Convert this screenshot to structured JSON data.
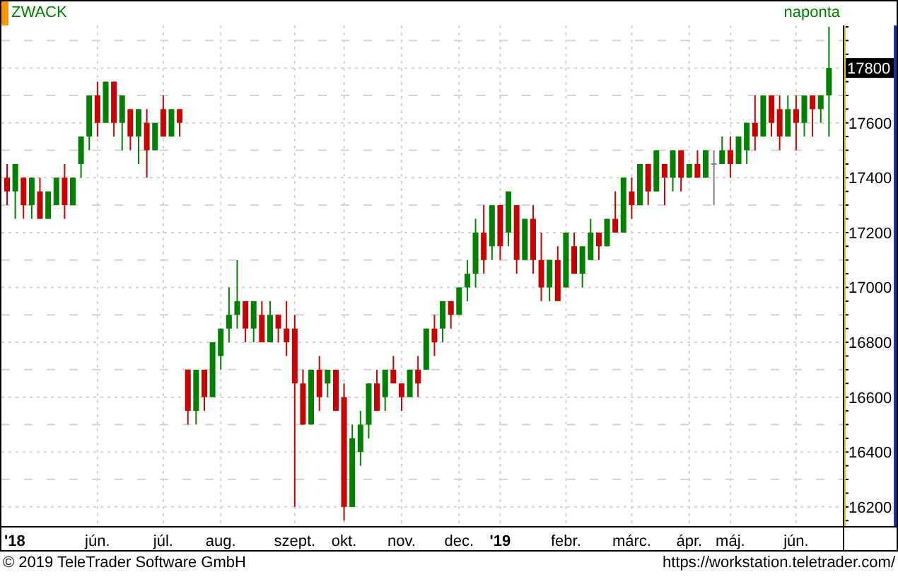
{
  "header": {
    "symbol": "ZWACK",
    "interval": "naponta"
  },
  "price_axis": {
    "last_price": "17800"
  },
  "chart_data": {
    "type": "candlestick",
    "grid": true,
    "ylim": [
      16130,
      17955
    ],
    "categories": [
      "'18",
      null,
      null,
      null,
      null,
      null,
      null,
      null,
      null,
      null,
      null,
      "jún.",
      null,
      null,
      null,
      null,
      null,
      null,
      null,
      "júl.",
      null,
      null,
      null,
      null,
      null,
      null,
      "aug.",
      null,
      null,
      null,
      null,
      null,
      null,
      null,
      null,
      "szept.",
      null,
      null,
      null,
      null,
      null,
      "okt.",
      null,
      null,
      null,
      null,
      null,
      null,
      "nov.",
      null,
      null,
      null,
      null,
      null,
      null,
      "dec.",
      null,
      null,
      null,
      null,
      "'19",
      null,
      null,
      null,
      null,
      null,
      null,
      null,
      "febr.",
      null,
      null,
      null,
      null,
      null,
      null,
      null,
      "márc.",
      null,
      null,
      null,
      null,
      null,
      null,
      "ápr.",
      null,
      null,
      null,
      null,
      "máj.",
      null,
      null,
      null,
      null,
      null,
      null,
      null,
      "jún.",
      null,
      null,
      null,
      null
    ],
    "yticks": [
      {
        "value": 17600,
        "label": "17600"
      },
      {
        "value": 17400,
        "label": "17400"
      },
      {
        "value": 17200,
        "label": "17200"
      },
      {
        "value": 17000,
        "label": "17000"
      },
      {
        "value": 16800,
        "label": "16800"
      },
      {
        "value": 16600,
        "label": "16600"
      },
      {
        "value": 16400,
        "label": "16400"
      },
      {
        "value": 16200,
        "label": "16200"
      }
    ],
    "ohlc": [
      [
        17400,
        17450,
        17300,
        17350
      ],
      [
        17350,
        17450,
        17250,
        17450
      ],
      [
        17400,
        17400,
        17250,
        17300
      ],
      [
        17300,
        17400,
        17250,
        17400
      ],
      [
        17350,
        17400,
        17250,
        17250
      ],
      [
        17250,
        17350,
        17250,
        17350
      ],
      [
        17300,
        17400,
        17300,
        17400
      ],
      [
        17400,
        17450,
        17250,
        17300
      ],
      [
        17300,
        17400,
        17300,
        17400
      ],
      [
        17450,
        17550,
        17400,
        17550
      ],
      [
        17550,
        17700,
        17500,
        17700
      ],
      [
        17700,
        17750,
        17550,
        17600
      ],
      [
        17600,
        17750,
        17600,
        17750
      ],
      [
        17750,
        17750,
        17550,
        17600
      ],
      [
        17600,
        17700,
        17500,
        17700
      ],
      [
        17650,
        17650,
        17500,
        17550
      ],
      [
        17550,
        17650,
        17450,
        17650
      ],
      [
        17600,
        17650,
        17400,
        17500
      ],
      [
        17500,
        17600,
        17500,
        17600
      ],
      [
        17650,
        17700,
        17550,
        17550
      ],
      [
        17550,
        17650,
        17550,
        17650
      ],
      [
        17650,
        17650,
        17550,
        17600
      ],
      [
        16700,
        16700,
        16500,
        16550
      ],
      [
        16550,
        16700,
        16500,
        16700
      ],
      [
        16700,
        16700,
        16550,
        16600
      ],
      [
        16600,
        16800,
        16600,
        16800
      ],
      [
        16750,
        16850,
        16700,
        16850
      ],
      [
        16850,
        17000,
        16800,
        16900
      ],
      [
        16900,
        17100,
        16850,
        16950
      ],
      [
        16950,
        16950,
        16800,
        16850
      ],
      [
        16850,
        16950,
        16800,
        16950
      ],
      [
        16900,
        16950,
        16800,
        16800
      ],
      [
        16800,
        16950,
        16800,
        16900
      ],
      [
        16900,
        16900,
        16800,
        16850
      ],
      [
        16850,
        16950,
        16750,
        16800
      ],
      [
        16850,
        16900,
        16200,
        16650
      ],
      [
        16650,
        16700,
        16500,
        16500
      ],
      [
        16500,
        16700,
        16500,
        16700
      ],
      [
        16700,
        16750,
        16550,
        16600
      ],
      [
        16650,
        16700,
        16600,
        16700
      ],
      [
        16700,
        16700,
        16550,
        16550
      ],
      [
        16600,
        16650,
        16150,
        16200
      ],
      [
        16200,
        16500,
        16200,
        16450
      ],
      [
        16400,
        16550,
        16350,
        16500
      ],
      [
        16500,
        16650,
        16450,
        16650
      ],
      [
        16650,
        16700,
        16550,
        16550
      ],
      [
        16600,
        16700,
        16550,
        16700
      ],
      [
        16700,
        16750,
        16650,
        16650
      ],
      [
        16650,
        16650,
        16550,
        16600
      ],
      [
        16600,
        16700,
        16600,
        16700
      ],
      [
        16700,
        16750,
        16600,
        16650
      ],
      [
        16700,
        16850,
        16700,
        16850
      ],
      [
        16850,
        16900,
        16750,
        16800
      ],
      [
        16850,
        16950,
        16800,
        16950
      ],
      [
        16950,
        16950,
        16850,
        16900
      ],
      [
        16900,
        17000,
        16900,
        17000
      ],
      [
        17000,
        17100,
        16950,
        17050
      ],
      [
        17050,
        17250,
        17000,
        17200
      ],
      [
        17200,
        17300,
        17050,
        17100
      ],
      [
        17150,
        17300,
        17100,
        17300
      ],
      [
        17300,
        17300,
        17100,
        17150
      ],
      [
        17200,
        17350,
        17150,
        17350
      ],
      [
        17300,
        17300,
        17050,
        17100
      ],
      [
        17100,
        17250,
        17100,
        17250
      ],
      [
        17250,
        17300,
        17050,
        17100
      ],
      [
        17100,
        17200,
        16950,
        17000
      ],
      [
        17000,
        17100,
        16950,
        17100
      ],
      [
        17100,
        17150,
        16950,
        16950
      ],
      [
        17000,
        17200,
        17000,
        17200
      ],
      [
        17150,
        17200,
        17050,
        17050
      ],
      [
        17050,
        17150,
        17000,
        17150
      ],
      [
        17100,
        17250,
        17100,
        17200
      ],
      [
        17200,
        17200,
        17100,
        17150
      ],
      [
        17150,
        17250,
        17150,
        17250
      ],
      [
        17250,
        17350,
        17200,
        17200
      ],
      [
        17200,
        17400,
        17200,
        17400
      ],
      [
        17350,
        17400,
        17250,
        17300
      ],
      [
        17300,
        17450,
        17300,
        17450
      ],
      [
        17450,
        17450,
        17300,
        17350
      ],
      [
        17350,
        17500,
        17350,
        17500
      ],
      [
        17450,
        17450,
        17300,
        17400
      ],
      [
        17400,
        17500,
        17350,
        17500
      ],
      [
        17500,
        17500,
        17350,
        17400
      ],
      [
        17400,
        17450,
        17400,
        17450
      ],
      [
        17450,
        17500,
        17400,
        17400
      ],
      [
        17400,
        17500,
        17400,
        17500
      ],
      [
        17450,
        17500,
        17300,
        17450
      ],
      [
        17450,
        17550,
        17450,
        17500
      ],
      [
        17500,
        17550,
        17400,
        17450
      ],
      [
        17450,
        17550,
        17450,
        17550
      ],
      [
        17500,
        17600,
        17450,
        17600
      ],
      [
        17600,
        17700,
        17500,
        17550
      ],
      [
        17550,
        17700,
        17550,
        17700
      ],
      [
        17700,
        17700,
        17550,
        17600
      ],
      [
        17650,
        17700,
        17500,
        17550
      ],
      [
        17550,
        17700,
        17550,
        17650
      ],
      [
        17650,
        17700,
        17500,
        17600
      ],
      [
        17600,
        17700,
        17550,
        17700
      ],
      [
        17700,
        17700,
        17550,
        17650
      ],
      [
        17650,
        17700,
        17600,
        17700
      ],
      [
        17700,
        17950,
        17550,
        17800
      ]
    ]
  },
  "time_axis": {
    "labels": [
      {
        "kind": "year"
      },
      {
        "kind": "month"
      },
      {
        "kind": "month"
      },
      {
        "kind": "month"
      },
      {
        "kind": "month"
      },
      {
        "kind": "month"
      },
      {
        "kind": "month"
      },
      {
        "kind": "month"
      },
      {
        "kind": "year"
      },
      {
        "kind": "month"
      },
      {
        "kind": "month"
      },
      {
        "kind": "month"
      },
      {
        "kind": "month"
      },
      {
        "kind": "month"
      }
    ]
  },
  "footer": {
    "copyright": "© 2019 TeleTrader Software GmbH",
    "url": "https://workstation.teletrader.com/"
  }
}
